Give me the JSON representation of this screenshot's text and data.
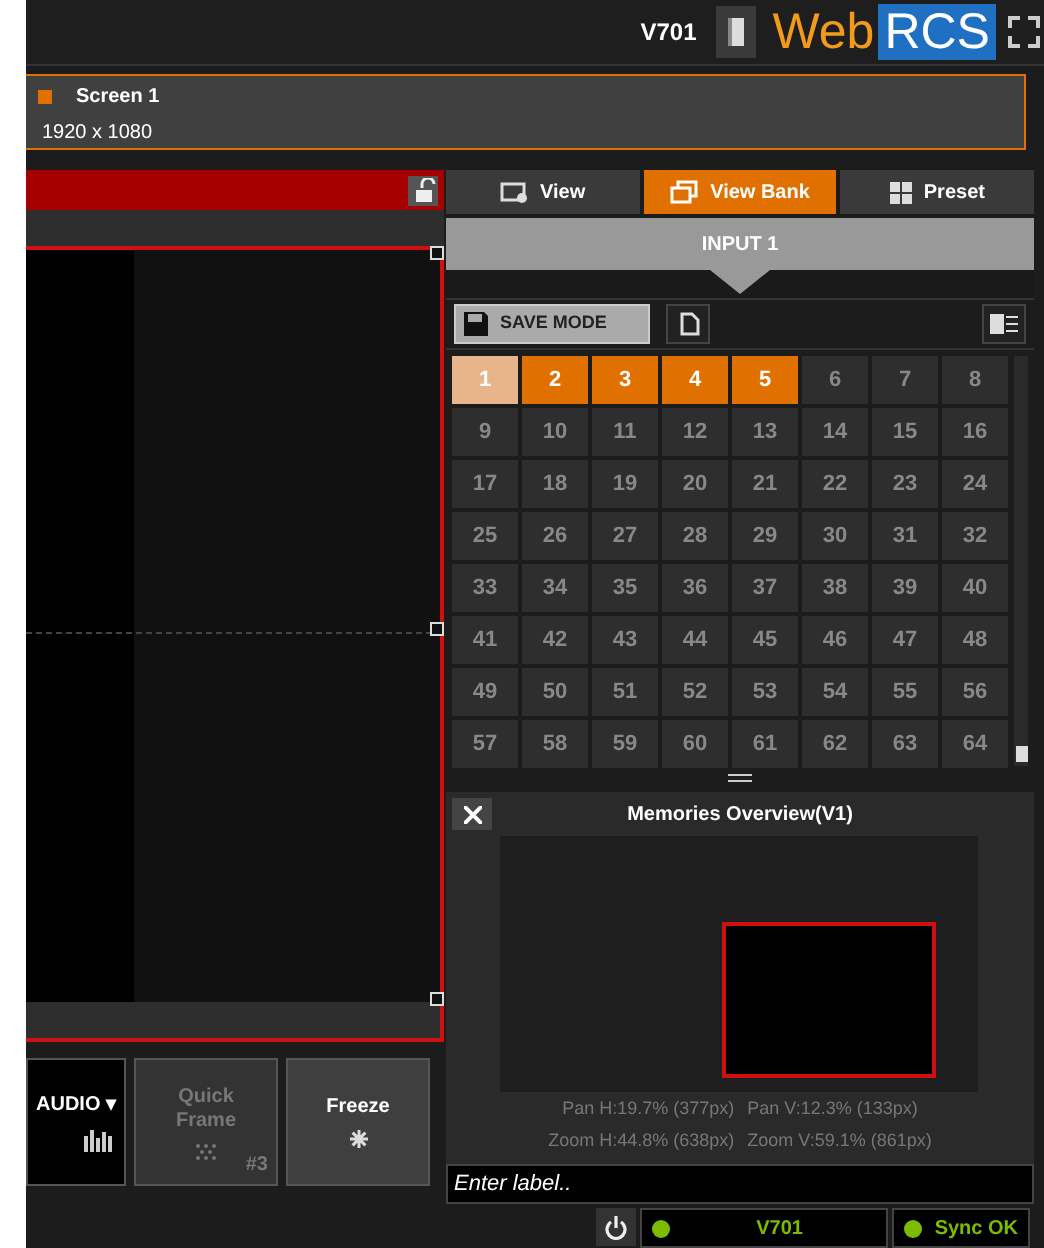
{
  "header": {
    "model": "V701",
    "logo_left": "Web",
    "logo_right": "RCS"
  },
  "screen": {
    "name": "Screen 1",
    "resolution": "1920 x 1080"
  },
  "layer": {
    "locked": false
  },
  "buttons": [
    {
      "kind": "audio",
      "label": "AUDIO ▾",
      "disabled": false
    },
    {
      "kind": "quick_frame",
      "label": "Quick Frame",
      "badge": "#3",
      "disabled": true
    },
    {
      "kind": "freeze",
      "label": "Freeze",
      "disabled": false
    }
  ],
  "tabs": [
    {
      "label": "View",
      "selected": false
    },
    {
      "label": "View Bank",
      "selected": true
    },
    {
      "label": "Preset",
      "selected": false
    }
  ],
  "input_title": "INPUT 1",
  "save_button": "SAVE MODE",
  "memories": [
    {
      "label": "1",
      "stored": true,
      "selected": true
    },
    {
      "label": "2",
      "stored": true,
      "selected": false
    },
    {
      "label": "3",
      "stored": true,
      "selected": false
    },
    {
      "label": "4",
      "stored": true,
      "selected": false
    },
    {
      "label": "5",
      "stored": true,
      "selected": false
    },
    {
      "label": "6",
      "stored": false,
      "selected": false
    },
    {
      "label": "7",
      "stored": false,
      "selected": false
    },
    {
      "label": "8",
      "stored": false,
      "selected": false
    },
    {
      "label": "9",
      "stored": false,
      "selected": false
    },
    {
      "label": "10",
      "stored": false,
      "selected": false
    },
    {
      "label": "11",
      "stored": false,
      "selected": false
    },
    {
      "label": "12",
      "stored": false,
      "selected": false
    },
    {
      "label": "13",
      "stored": false,
      "selected": false
    },
    {
      "label": "14",
      "stored": false,
      "selected": false
    },
    {
      "label": "15",
      "stored": false,
      "selected": false
    },
    {
      "label": "16",
      "stored": false,
      "selected": false
    },
    {
      "label": "17",
      "stored": false,
      "selected": false
    },
    {
      "label": "18",
      "stored": false,
      "selected": false
    },
    {
      "label": "19",
      "stored": false,
      "selected": false
    },
    {
      "label": "20",
      "stored": false,
      "selected": false
    },
    {
      "label": "21",
      "stored": false,
      "selected": false
    },
    {
      "label": "22",
      "stored": false,
      "selected": false
    },
    {
      "label": "23",
      "stored": false,
      "selected": false
    },
    {
      "label": "24",
      "stored": false,
      "selected": false
    },
    {
      "label": "25",
      "stored": false,
      "selected": false
    },
    {
      "label": "26",
      "stored": false,
      "selected": false
    },
    {
      "label": "27",
      "stored": false,
      "selected": false
    },
    {
      "label": "28",
      "stored": false,
      "selected": false
    },
    {
      "label": "29",
      "stored": false,
      "selected": false
    },
    {
      "label": "30",
      "stored": false,
      "selected": false
    },
    {
      "label": "31",
      "stored": false,
      "selected": false
    },
    {
      "label": "32",
      "stored": false,
      "selected": false
    },
    {
      "label": "33",
      "stored": false,
      "selected": false
    },
    {
      "label": "34",
      "stored": false,
      "selected": false
    },
    {
      "label": "35",
      "stored": false,
      "selected": false
    },
    {
      "label": "36",
      "stored": false,
      "selected": false
    },
    {
      "label": "37",
      "stored": false,
      "selected": false
    },
    {
      "label": "38",
      "stored": false,
      "selected": false
    },
    {
      "label": "39",
      "stored": false,
      "selected": false
    },
    {
      "label": "40",
      "stored": false,
      "selected": false
    },
    {
      "label": "41",
      "stored": false,
      "selected": false
    },
    {
      "label": "42",
      "stored": false,
      "selected": false
    },
    {
      "label": "43",
      "stored": false,
      "selected": false
    },
    {
      "label": "44",
      "stored": false,
      "selected": false
    },
    {
      "label": "45",
      "stored": false,
      "selected": false
    },
    {
      "label": "46",
      "stored": false,
      "selected": false
    },
    {
      "label": "47",
      "stored": false,
      "selected": false
    },
    {
      "label": "48",
      "stored": false,
      "selected": false
    },
    {
      "label": "49",
      "stored": false,
      "selected": false
    },
    {
      "label": "50",
      "stored": false,
      "selected": false
    },
    {
      "label": "51",
      "stored": false,
      "selected": false
    },
    {
      "label": "52",
      "stored": false,
      "selected": false
    },
    {
      "label": "53",
      "stored": false,
      "selected": false
    },
    {
      "label": "54",
      "stored": false,
      "selected": false
    },
    {
      "label": "55",
      "stored": false,
      "selected": false
    },
    {
      "label": "56",
      "stored": false,
      "selected": false
    },
    {
      "label": "57",
      "stored": false,
      "selected": false
    },
    {
      "label": "58",
      "stored": false,
      "selected": false
    },
    {
      "label": "59",
      "stored": false,
      "selected": false
    },
    {
      "label": "60",
      "stored": false,
      "selected": false
    },
    {
      "label": "61",
      "stored": false,
      "selected": false
    },
    {
      "label": "62",
      "stored": false,
      "selected": false
    },
    {
      "label": "63",
      "stored": false,
      "selected": false
    },
    {
      "label": "64",
      "stored": false,
      "selected": false
    }
  ],
  "overview": {
    "title": "Memories Overview(V1)",
    "pan_h": "Pan H:19.7% (377px)",
    "pan_v": "Pan V:12.3% (133px)",
    "zoom_h": "Zoom H:44.8% (638px)",
    "zoom_v": "Zoom V:59.1% (861px)",
    "label_placeholder": "Enter label.."
  },
  "status": {
    "device": "V701",
    "sync": "Sync OK"
  }
}
